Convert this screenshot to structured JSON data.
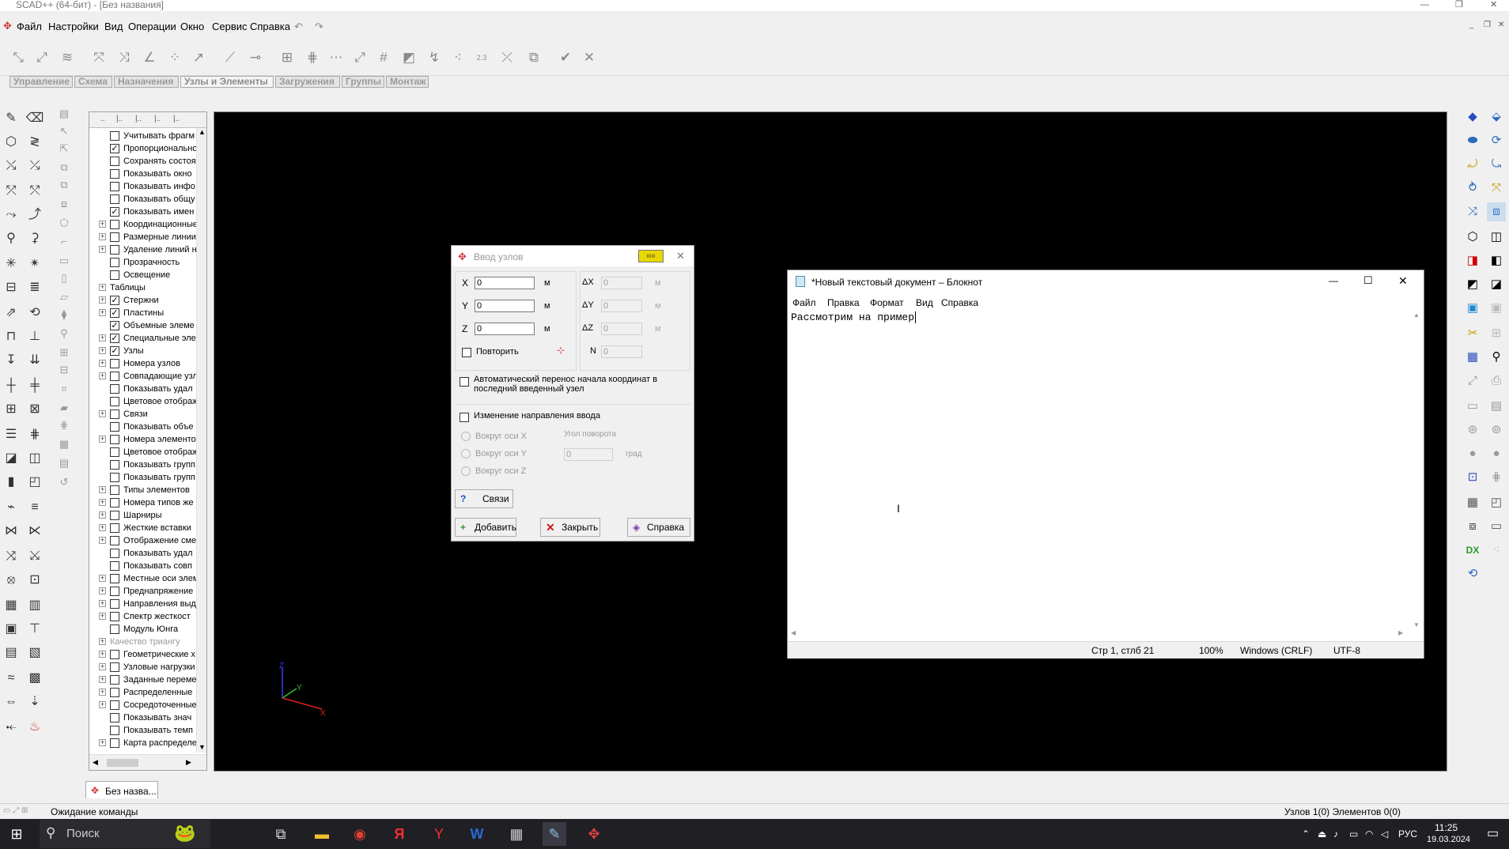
{
  "window": {
    "title": "SCAD++ (64-бит) - [Без названия]"
  },
  "menubar": {
    "items": [
      "Файл",
      "Настройки",
      "Вид",
      "Операции",
      "Окно",
      "Сервис",
      "Справка"
    ]
  },
  "tabs": [
    {
      "label": "Управление"
    },
    {
      "label": "Схема"
    },
    {
      "label": "Назначения"
    },
    {
      "label": "Узлы и Элементы",
      "active": true
    },
    {
      "label": "Загружения"
    },
    {
      "label": "Группы"
    },
    {
      "label": "Монтаж"
    }
  ],
  "tree": {
    "items": [
      {
        "label": "Учитывать фрагм",
        "checked": false,
        "expand": false
      },
      {
        "label": "Пропорционально",
        "checked": true,
        "expand": false
      },
      {
        "label": "Сохранять состоя",
        "checked": false,
        "expand": false
      },
      {
        "label": "Показывать окно",
        "checked": false,
        "expand": false
      },
      {
        "label": "Показывать инфо",
        "checked": false,
        "expand": false
      },
      {
        "label": "Показывать общу",
        "checked": false,
        "expand": false
      },
      {
        "label": "Показывать имен",
        "checked": true,
        "expand": false
      },
      {
        "label": "Координационные",
        "checked": false,
        "expand": true
      },
      {
        "label": "Размерные линии",
        "checked": false,
        "expand": true
      },
      {
        "label": "Удаление линий н",
        "checked": false,
        "expand": true
      },
      {
        "label": "Прозрачность",
        "checked": false,
        "expand": false
      },
      {
        "label": "Освещение",
        "checked": false,
        "expand": false
      },
      {
        "label": "Таблицы",
        "checked": null,
        "expand": true
      },
      {
        "label": "Стержни",
        "checked": true,
        "expand": true
      },
      {
        "label": "Пластины",
        "checked": true,
        "expand": true
      },
      {
        "label": "Объемные элеме",
        "checked": true,
        "expand": false
      },
      {
        "label": "Специальные эле",
        "checked": true,
        "expand": true
      },
      {
        "label": "Узлы",
        "checked": true,
        "expand": true
      },
      {
        "label": "Номера узлов",
        "checked": false,
        "expand": true
      },
      {
        "label": "Совпадающие узл",
        "checked": false,
        "expand": true
      },
      {
        "label": "Показывать удал",
        "checked": false,
        "expand": false
      },
      {
        "label": "Цветовое отображ",
        "checked": false,
        "expand": false
      },
      {
        "label": "Связи",
        "checked": false,
        "expand": true
      },
      {
        "label": "Показывать объе",
        "checked": false,
        "expand": false
      },
      {
        "label": "Номера элементо",
        "checked": false,
        "expand": true
      },
      {
        "label": "Цветовое отображ",
        "checked": false,
        "expand": false
      },
      {
        "label": "Показывать групп",
        "checked": false,
        "expand": false
      },
      {
        "label": "Показывать групп",
        "checked": false,
        "expand": false
      },
      {
        "label": "Типы элементов",
        "checked": false,
        "expand": true
      },
      {
        "label": "Номера типов же",
        "checked": false,
        "expand": true
      },
      {
        "label": "Шарниры",
        "checked": false,
        "expand": true
      },
      {
        "label": "Жесткие вставки",
        "checked": false,
        "expand": true
      },
      {
        "label": "Отображение сме",
        "checked": false,
        "expand": true
      },
      {
        "label": "Показывать удал",
        "checked": false,
        "expand": false
      },
      {
        "label": "Показывать совп",
        "checked": false,
        "expand": false
      },
      {
        "label": "Местные оси элем",
        "checked": false,
        "expand": true
      },
      {
        "label": "Преднапряжение",
        "checked": false,
        "expand": true
      },
      {
        "label": "Направления выд",
        "checked": false,
        "expand": true
      },
      {
        "label": "Спектр жесткост",
        "checked": false,
        "expand": true
      },
      {
        "label": "Модуль Юнга",
        "checked": false,
        "expand": false
      },
      {
        "label": "Качество триангу",
        "checked": null,
        "expand": true,
        "grey": true
      },
      {
        "label": "Геометрические х",
        "checked": false,
        "expand": true
      },
      {
        "label": "Узловые нагрузки",
        "checked": false,
        "expand": true
      },
      {
        "label": "Заданные переме",
        "checked": false,
        "expand": true
      },
      {
        "label": "Распределенные",
        "checked": false,
        "expand": true
      },
      {
        "label": "Сосредоточенные",
        "checked": false,
        "expand": true
      },
      {
        "label": "Показывать знач",
        "checked": false,
        "expand": false
      },
      {
        "label": "Показывать темп",
        "checked": false,
        "expand": false
      },
      {
        "label": "Карта распределе",
        "checked": false,
        "expand": true
      }
    ]
  },
  "axes": {
    "x": "X",
    "y": "Y",
    "z": "Z"
  },
  "dialog": {
    "title": "Ввод узлов",
    "x_label": "X",
    "x_value": "0",
    "y_label": "Y",
    "y_value": "0",
    "z_label": "Z",
    "z_value": "0",
    "unit": "м",
    "dx_label": "ΔX",
    "dx_value": "0",
    "dy_label": "ΔY",
    "dy_value": "0",
    "dz_label": "ΔZ",
    "dz_value": "0",
    "n_label": "N",
    "n_value": "0",
    "repeat_label": "Повторить",
    "auto_transfer_label": "Автоматический перенос начала координат в последний введенный узел",
    "change_dir_label": "Изменение направления ввода",
    "around_x": "Вокруг оси X",
    "around_y": "Вокруг оси Y",
    "around_z": "Вокруг оси Z",
    "angle_label": "Угол поворота",
    "angle_value": "0",
    "angle_unit": "град",
    "links_button": "Связи",
    "add_button": "Добавить",
    "close_button": "Закрыть",
    "help_button": "Справка"
  },
  "notepad": {
    "title": "*Новый текстовый документ – Блокнот",
    "menu": [
      "Файл",
      "Правка",
      "Формат",
      "Вид",
      "Справка"
    ],
    "text": "Рассмотрим на пример",
    "status": {
      "position": "Стр 1, стлб 21",
      "zoom": "100%",
      "eol": "Windows (CRLF)",
      "encoding": "UTF-8"
    }
  },
  "doc_tab": {
    "label": "Без назва..."
  },
  "statusbar": {
    "left": "Ожидание команды",
    "right": "Узлов 1(0) Элементов 0(0)"
  },
  "taskbar": {
    "search": "Поиск",
    "lang": "РУС",
    "time": "11:25",
    "date": "19.03.2024"
  }
}
